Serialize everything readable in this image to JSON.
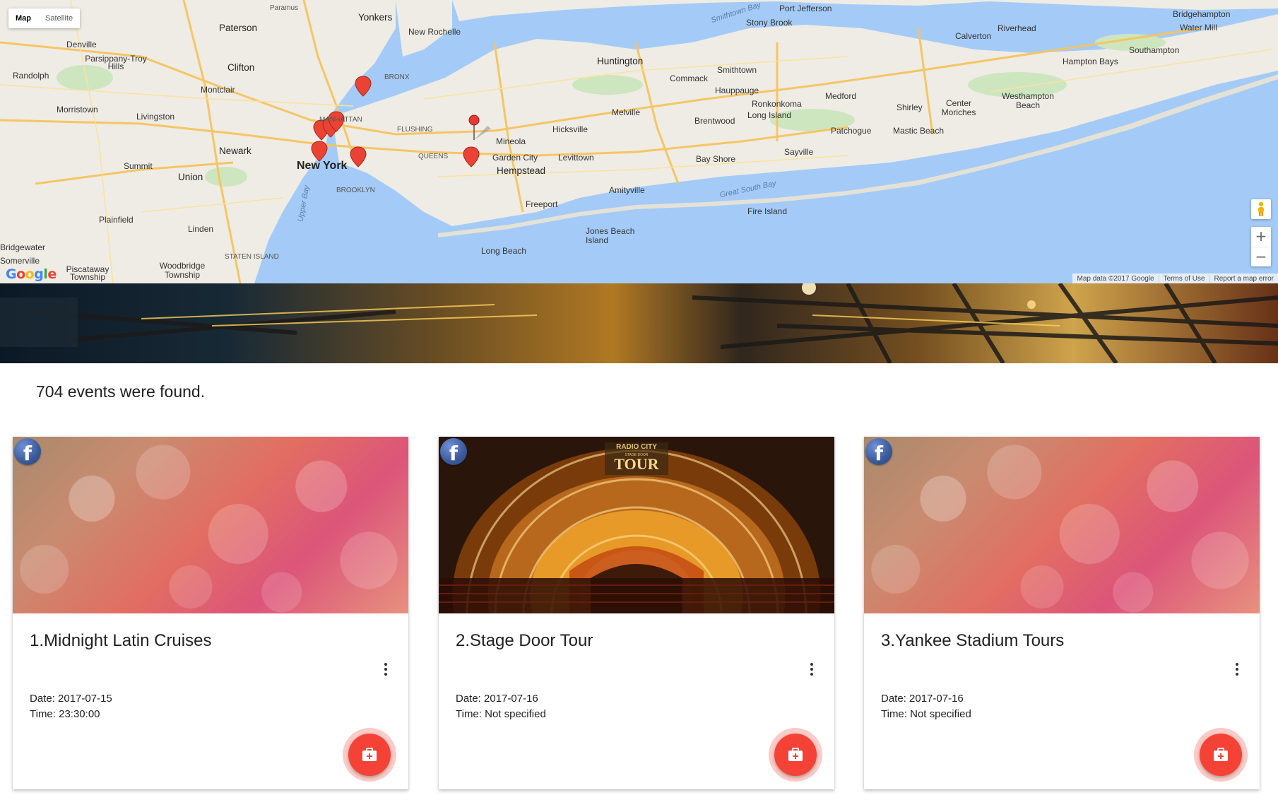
{
  "map": {
    "type_controls": {
      "map": "Map",
      "satellite": "Satellite"
    },
    "zoom": {
      "in": "+",
      "out": "−"
    },
    "footer": {
      "data": "Map data ©2017 Google",
      "terms": "Terms of Use",
      "report": "Report a map error"
    },
    "logo": "Google",
    "labels": {
      "new_york": "New York",
      "newark": "Newark",
      "yonkers": "Yonkers",
      "new_rochelle": "New Rochelle",
      "paterson": "Paterson",
      "clifton": "Clifton",
      "paramus": "Paramus",
      "huntington": "Huntington",
      "hempstead": "Hempstead",
      "mineola": "Mineola",
      "garden_city": "Garden City",
      "levittown": "Levittown",
      "hicksville": "Hicksville",
      "freeport": "Freeport",
      "long_beach": "Long Beach",
      "long_island": "Long Island",
      "bay_shore": "Bay Shore",
      "brentwood": "Brentwood",
      "smithtown": "Smithtown",
      "hauppauge": "Hauppauge",
      "ronkonkoma": "Ronkonkoma",
      "patchogue": "Patchogue",
      "medford": "Medford",
      "shirley": "Shirley",
      "sayville": "Sayville",
      "fire_island": "Fire Island",
      "great_south_bay": "Great South Bay",
      "jones_beach": "Jones Beach Island",
      "amityville": "Amityville",
      "melville": "Melville",
      "commack": "Commack",
      "stony_brook": "Stony Brook",
      "port_jefferson": "Port Jefferson",
      "smithtown_bay": "Smithtown Bay",
      "riverhead": "Riverhead",
      "calverton": "Calverton",
      "southampton": "Southampton",
      "hampton_bays": "Hampton Bays",
      "westhampton": "Westhampton Beach",
      "center_moriches": "Center Moriches",
      "mastic_beach": "Mastic Beach",
      "bridgehampton": "Bridgehampton",
      "water_mill": "Water Mill",
      "denville": "Denville",
      "parsippany": "Parsippany-Troy Hills",
      "randolph": "Randolph",
      "morristown": "Morristown",
      "livingston": "Livingston",
      "montclair": "Montclair",
      "summit": "Summit",
      "union": "Union",
      "plainfield": "Plainfield",
      "linden": "Linden",
      "woodbridge": "Woodbridge Township",
      "piscataway": "Piscataway Township",
      "edgewater": "Bridgewater",
      "somerville": "Somerville",
      "staten_island": "STATEN ISLAND",
      "brooklyn": "BROOKLYN",
      "queens": "QUEENS",
      "bronx": "BRONX",
      "flushing": "FLUSHING",
      "manhattan": "MANHATTAN",
      "upper_bay": "Upper Bay"
    }
  },
  "results_text": "704 events were found.",
  "cards": [
    {
      "title": "1.Midnight Latin Cruises",
      "date": "Date: 2017-07-15",
      "time": "Time: 23:30:00"
    },
    {
      "title": "2.Stage Door Tour",
      "date": "Date: 2017-07-16",
      "time": "Time: Not specified",
      "image_text_top": "RADIO CITY",
      "image_text_mid": "STAGE DOOR",
      "image_text_main": "TOUR"
    },
    {
      "title": "3.Yankee Stadium Tours",
      "date": "Date: 2017-07-16",
      "time": "Time: Not specified"
    }
  ],
  "colors": {
    "accent": "#f44336",
    "facebook": "#3b5998",
    "water": "#a4cbf7",
    "land": "#eeece4"
  }
}
